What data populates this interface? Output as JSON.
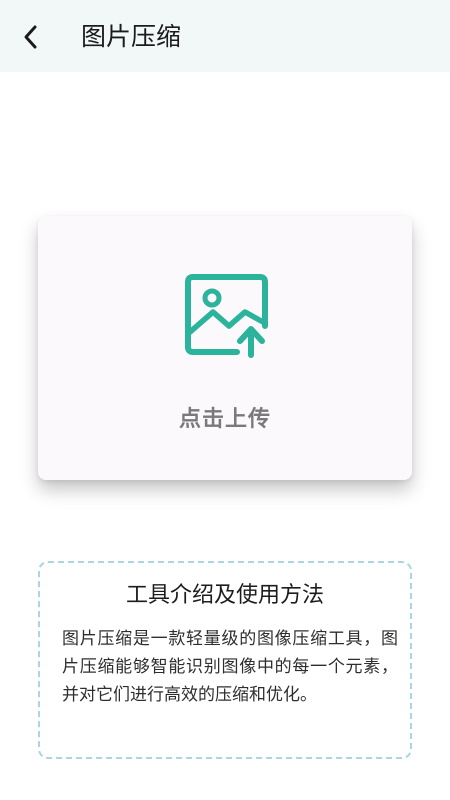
{
  "header": {
    "back_icon": "chevron-left-icon",
    "title": "图片压缩",
    "background": "#f2f8f8"
  },
  "upload": {
    "icon": "image-upload-icon",
    "icon_color": "#2bb39b",
    "label": "点击上传"
  },
  "info": {
    "title": "工具介绍及使用方法",
    "body": "图片压缩是一款轻量级的图像压缩工具，图片压缩能够智能识别图像中的每一个元素，并对它们进行高效的压缩和优化。",
    "border_color": "#a9d6e0"
  }
}
